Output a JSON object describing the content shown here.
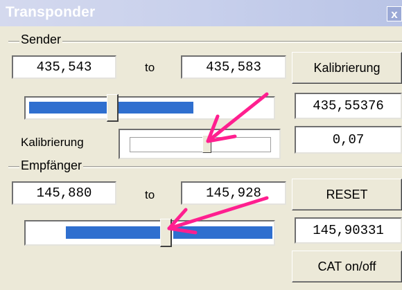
{
  "window": {
    "title": "Transponder",
    "close_glyph": "x",
    "colors": {
      "titlebar": "#c8d0ec",
      "accent": "#2f6fcf",
      "arrow": "#ff1f8f"
    }
  },
  "sender": {
    "group_label": "Sender",
    "from_value": "435,543",
    "to_label": "to",
    "to_value": "435,583",
    "calibrate_button": "Kalibrierung",
    "slider_fill_fraction": 0.45,
    "current_value": "435,55376",
    "calibration_label": "Kalibrierung",
    "calibration_value": "0,07"
  },
  "receiver": {
    "group_label": "Empfänger",
    "from_value": "145,880",
    "to_label": "to",
    "to_value": "145,928",
    "reset_button": "RESET",
    "current_value": "145,90331",
    "cat_button": "CAT on/off"
  }
}
